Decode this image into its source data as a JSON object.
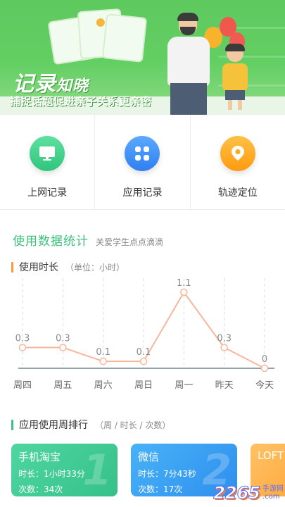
{
  "banner": {
    "title_main": "记录",
    "title_small": "知晓",
    "subtitle": "捕捉话题促进亲子关系更亲密"
  },
  "menu": [
    {
      "label": "上网记录",
      "icon": "monitor-icon",
      "color": "#3ccf86"
    },
    {
      "label": "应用记录",
      "icon": "apps-grid-icon",
      "color": "#3f8ff5"
    },
    {
      "label": "轨迹定位",
      "icon": "location-pin-icon",
      "color": "#ffa31a"
    }
  ],
  "stats": {
    "title": "使用数据统计",
    "subtitle": "关爱学生点点滴滴"
  },
  "usage": {
    "title": "使用时长",
    "unit": "（单位：小时）",
    "accent": "#ff9a3c"
  },
  "chart_data": {
    "type": "line",
    "categories": [
      "周四",
      "周五",
      "周六",
      "周日",
      "周一",
      "昨天",
      "今天"
    ],
    "values": [
      0.3,
      0.3,
      0.1,
      0.1,
      1.1,
      0.3,
      0
    ],
    "value_labels": [
      "0.3",
      "0.3",
      "0.1",
      "0.1",
      "1.1",
      "0.3",
      "0"
    ],
    "ylim": [
      0,
      1.1
    ],
    "line_color": "#f6b79d",
    "grid": "vertical dashed"
  },
  "ranking": {
    "title": "应用使用周排行",
    "note": "（周 / 时长 / 次数）",
    "accent": "#3cc08f",
    "items": [
      {
        "name": "手机淘宝",
        "duration": "时长：1小时33分",
        "count": "次数：34次",
        "rank": "1",
        "color": "#42cc97"
      },
      {
        "name": "微信",
        "duration": "时长：7分43秒",
        "count": "次数：17次",
        "rank": "2",
        "color": "#3ba0f2"
      },
      {
        "name": "LOFT",
        "duration": "",
        "count": "",
        "rank": "",
        "color": "#ffb34a"
      }
    ]
  },
  "watermark": {
    "number": "2265",
    "text_top": "手游网",
    "text_bottom": ".com"
  }
}
